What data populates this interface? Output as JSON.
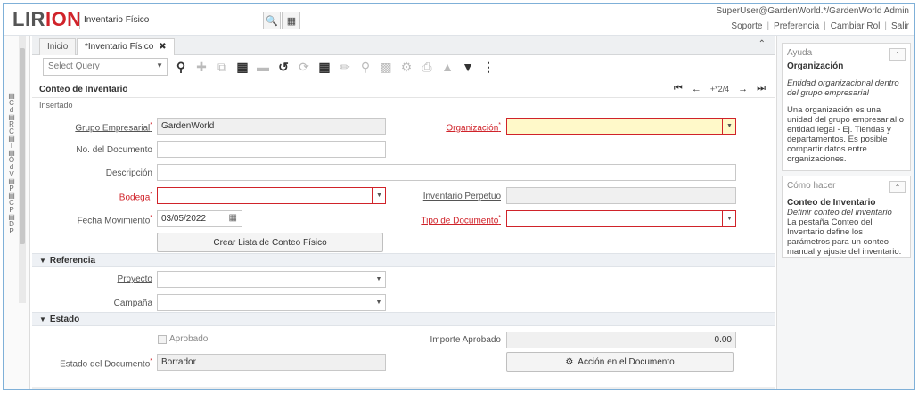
{
  "app": {
    "logo_part1": "LIR",
    "logo_part2": "ION",
    "global_search_value": "Inventario Físico",
    "user": "SuperUser@GardenWorld.*/GardenWorld Admin",
    "links": [
      "Soporte",
      "Preferencia",
      "Cambiar Rol",
      "Salir"
    ]
  },
  "tabs": [
    {
      "label": "Inicio"
    },
    {
      "label": "*Inventario Físico"
    }
  ],
  "toolbar": {
    "query_placeholder": "Select Query"
  },
  "window": {
    "title": "Conteo de Inventario",
    "record_position": "+*2/4",
    "status": "Insertado"
  },
  "form": {
    "grupo_empresarial": {
      "label": "Grupo Empresarial",
      "value": "GardenWorld"
    },
    "organizacion": {
      "label": "Organización",
      "value": ""
    },
    "no_documento": {
      "label": "No. del Documento",
      "value": ""
    },
    "descripcion": {
      "label": "Descripción",
      "value": ""
    },
    "bodega": {
      "label": "Bodega",
      "value": ""
    },
    "inventario_perpetuo": {
      "label": "Inventario Perpetuo",
      "value": ""
    },
    "fecha_movimiento": {
      "label": "Fecha Movimiento",
      "value": "03/05/2022"
    },
    "tipo_documento": {
      "label": "Tipo de Documento",
      "value": ""
    },
    "crear_lista_button": "Crear Lista de Conteo Físico"
  },
  "section_referencia": {
    "title": "Referencia",
    "proyecto": {
      "label": "Proyecto",
      "value": ""
    },
    "campana": {
      "label": "Campaña",
      "value": ""
    }
  },
  "section_estado": {
    "title": "Estado",
    "aprobado_label": "Aprobado",
    "aprobado_checked": false,
    "importe_aprobado": {
      "label": "Importe Aprobado",
      "value": "0.00"
    },
    "estado_documento": {
      "label": "Estado del Documento",
      "value": "Borrador"
    },
    "accion_button": "Acción en el Documento"
  },
  "help": {
    "ayuda_header": "Ayuda",
    "ayuda_title": "Organización",
    "ayuda_italic": "Entidad organizacional dentro del grupo empresarial",
    "ayuda_text": "Una organización es una unidad del grupo empresarial o entidad legal - Ej. Tiendas y departamentos. Es posible compartir datos entre organizaciones.",
    "como_header": "Cómo hacer",
    "como_title": "Conteo de Inventario",
    "como_italic": "Definir conteo del inventario",
    "como_text": "La pestaña Conteo del Inventario define los parámetros para un conteo manual y ajuste del inventario."
  },
  "rail_letters": "C d R C Tr Ó d V P P C P D P"
}
